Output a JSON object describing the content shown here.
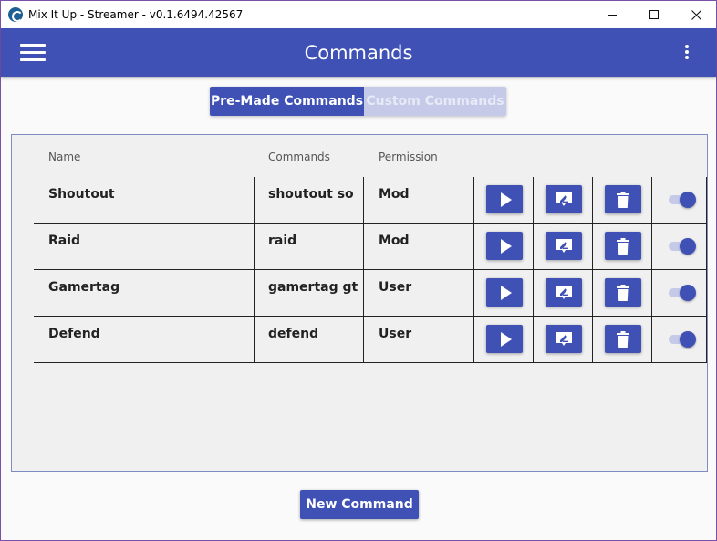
{
  "window": {
    "title": "Mix It Up - Streamer - v0.1.6494.42567"
  },
  "appbar": {
    "title": "Commands"
  },
  "tabs": [
    {
      "label": "Pre-Made Commands",
      "active": true
    },
    {
      "label": "Custom Commands",
      "active": false
    }
  ],
  "table": {
    "headers": {
      "name": "Name",
      "commands": "Commands",
      "permission": "Permission"
    },
    "rows": [
      {
        "name": "Shoutout",
        "commands": "shoutout so",
        "permission": "Mod",
        "enabled": true
      },
      {
        "name": "Raid",
        "commands": "raid",
        "permission": "Mod",
        "enabled": true
      },
      {
        "name": "Gamertag",
        "commands": "gamertag gt",
        "permission": "User",
        "enabled": true
      },
      {
        "name": "Defend",
        "commands": "defend",
        "permission": "User",
        "enabled": true
      }
    ],
    "row_actions": [
      "play-icon",
      "edit-icon",
      "delete-icon"
    ]
  },
  "footer": {
    "new_command_label": "New Command"
  },
  "colors": {
    "primary": "#3f51b5",
    "primary_light": "#c5cae9",
    "window_border": "#7a4fa6"
  }
}
